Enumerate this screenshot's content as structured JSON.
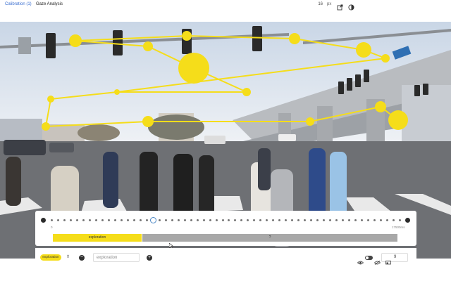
{
  "header": {
    "tabs": [
      {
        "label": "Calibration (1)",
        "active": true
      },
      {
        "label": "Gaze Analysis",
        "active": false
      }
    ],
    "px_value": "16",
    "px_unit": "px",
    "open_icon": "external-link-icon",
    "theme_icon": "contrast-icon"
  },
  "scene": {
    "description_icon": "street-scene-image",
    "gaze_color": "#f5dd1a"
  },
  "timeline": {
    "start_label": "0",
    "end_label": "17500ms",
    "dot_count": 56,
    "current_index": 16,
    "segments": [
      {
        "label": "exploration",
        "color": "#f5dd1a",
        "fraction": 0.26
      },
      {
        "label": "?",
        "color": "#a8a8a8",
        "fraction": 0.74
      }
    ]
  },
  "toolbar": {
    "label_value": "exploration",
    "label_input_value": "exploration",
    "remove_symbol": "−",
    "add_symbol": "+",
    "count_value": "9"
  }
}
